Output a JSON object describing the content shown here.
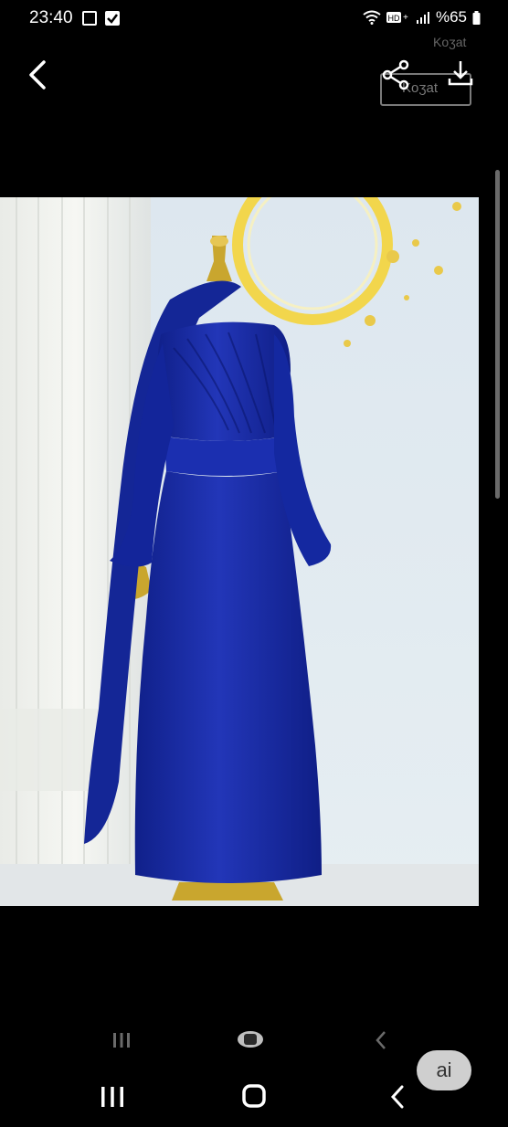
{
  "status_bar": {
    "time": "23:40",
    "battery_text": "%65",
    "icons": [
      "gallery-icon",
      "check-icon",
      "wifi-icon",
      "hd-plus-icon",
      "signal-icon",
      "battery-icon"
    ]
  },
  "toolbar": {
    "back_icon": "chevron-left-icon",
    "share_icon": "share-icon",
    "download_icon": "download-icon"
  },
  "watermark": {
    "text_top": "Koʒat",
    "text_box": "Koʒat"
  },
  "photo": {
    "subject": "royal blue draped evening dress on mannequin",
    "colors": {
      "dress": "#1a2ea8",
      "wall": "#dfe9ef",
      "curtain": "#f1f2ee",
      "gold": "#f2d64c"
    }
  },
  "inner_nav": {
    "icons": [
      "recents-icon",
      "home-icon",
      "back-icon"
    ]
  },
  "ai_button": {
    "label": "ai"
  },
  "system_nav": {
    "icons": [
      "recents-icon",
      "home-icon",
      "back-icon"
    ]
  }
}
